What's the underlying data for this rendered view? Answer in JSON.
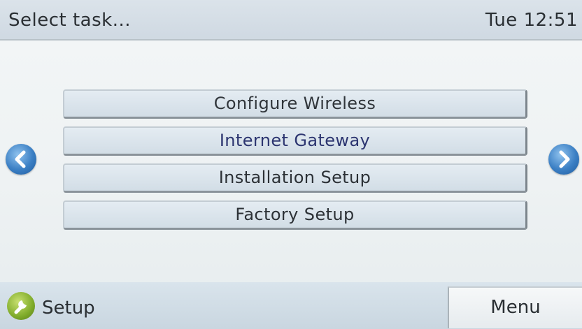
{
  "header": {
    "title": "Select task...",
    "clock": "Tue 12:51"
  },
  "tasks": [
    {
      "label": "Configure Wireless"
    },
    {
      "label": "Internet Gateway"
    },
    {
      "label": "Installation Setup"
    },
    {
      "label": "Factory Setup"
    }
  ],
  "nav": {
    "prev_icon": "chevron-left-icon",
    "next_icon": "chevron-right-icon",
    "color": "#3b7fc4"
  },
  "footer": {
    "setup_label": "Setup",
    "setup_icon": "wrench-icon",
    "setup_icon_color": "#7fab2a",
    "menu_label": "Menu"
  }
}
